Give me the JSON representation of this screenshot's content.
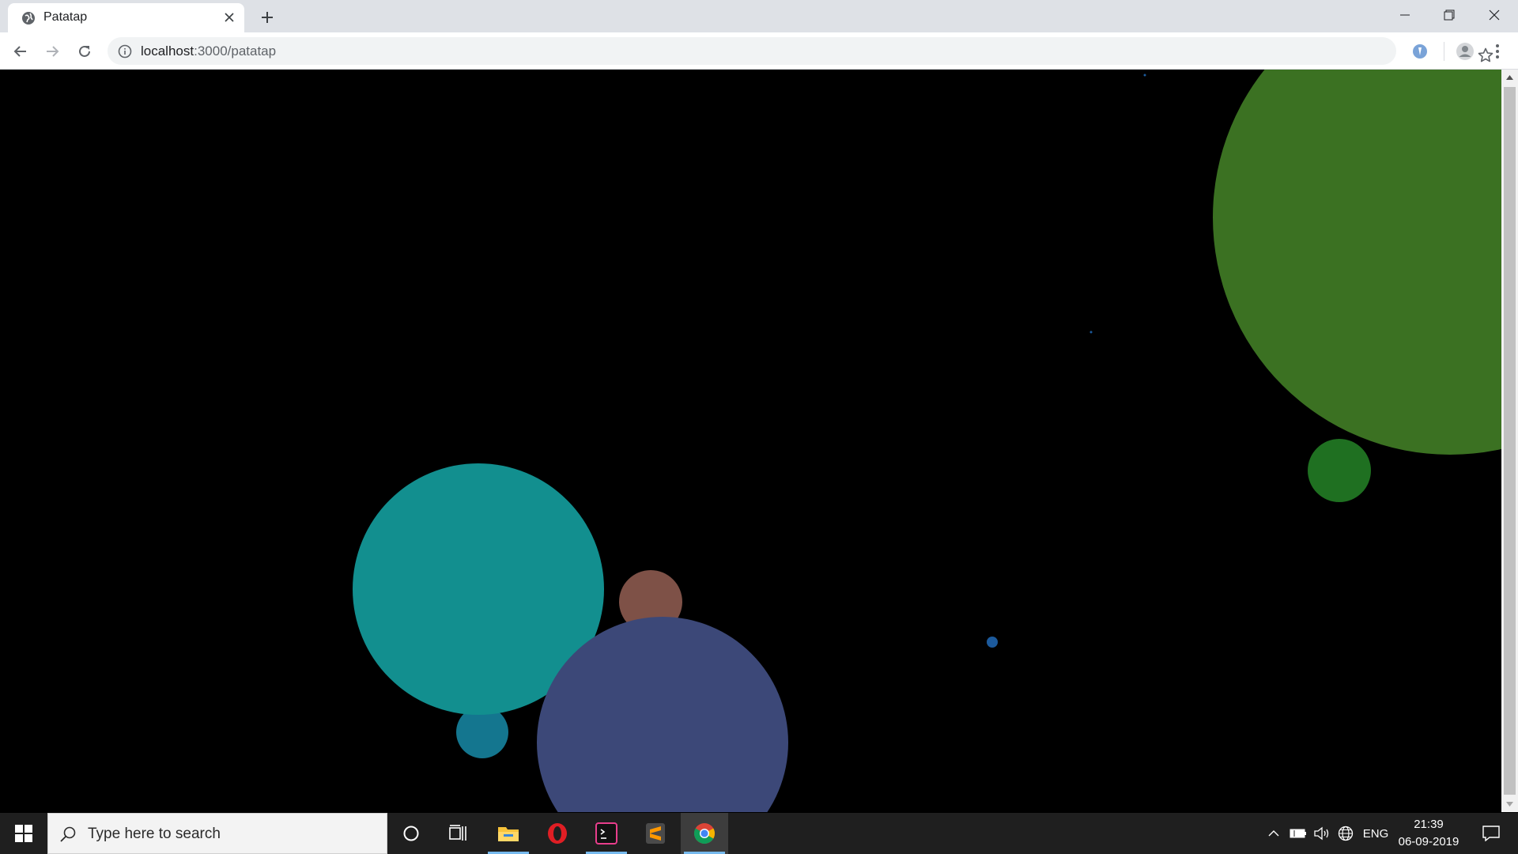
{
  "browser": {
    "tab_title": "Patatap",
    "url_host": "localhost",
    "url_rest": ":3000/patatap",
    "icons": [
      "globe-icon",
      "close-icon",
      "plus-icon",
      "minimize-icon",
      "restore-icon",
      "window-close-icon",
      "back-arrow-icon",
      "forward-arrow-icon",
      "reload-icon",
      "info-icon",
      "star-icon",
      "extension-icon",
      "profile-icon",
      "menu-dots-icon"
    ]
  },
  "page": {
    "background": "#000000",
    "circles": [
      {
        "name": "green-large-circle",
        "color": "#3b7122"
      },
      {
        "name": "green-small-circle",
        "color": "#1f7021"
      },
      {
        "name": "teal-circle",
        "color": "#128f8f"
      },
      {
        "name": "blue-small-circle",
        "color": "#14768f"
      },
      {
        "name": "brown-circle",
        "color": "#7e5147"
      },
      {
        "name": "indigo-circle",
        "color": "#3c4878"
      },
      {
        "name": "blue-dot",
        "color": "#1c5a9c"
      }
    ]
  },
  "taskbar": {
    "search_placeholder": "Type here to search",
    "apps": [
      "cortana-icon",
      "task-view-icon",
      "file-explorer-icon",
      "opera-icon",
      "terminal-icon",
      "sublime-text-icon",
      "chrome-icon"
    ],
    "tray_icons": [
      "chevron-up-icon",
      "battery-icon",
      "volume-icon",
      "network-globe-icon"
    ],
    "language": "ENG",
    "time": "21:39",
    "date": "06-09-2019"
  }
}
